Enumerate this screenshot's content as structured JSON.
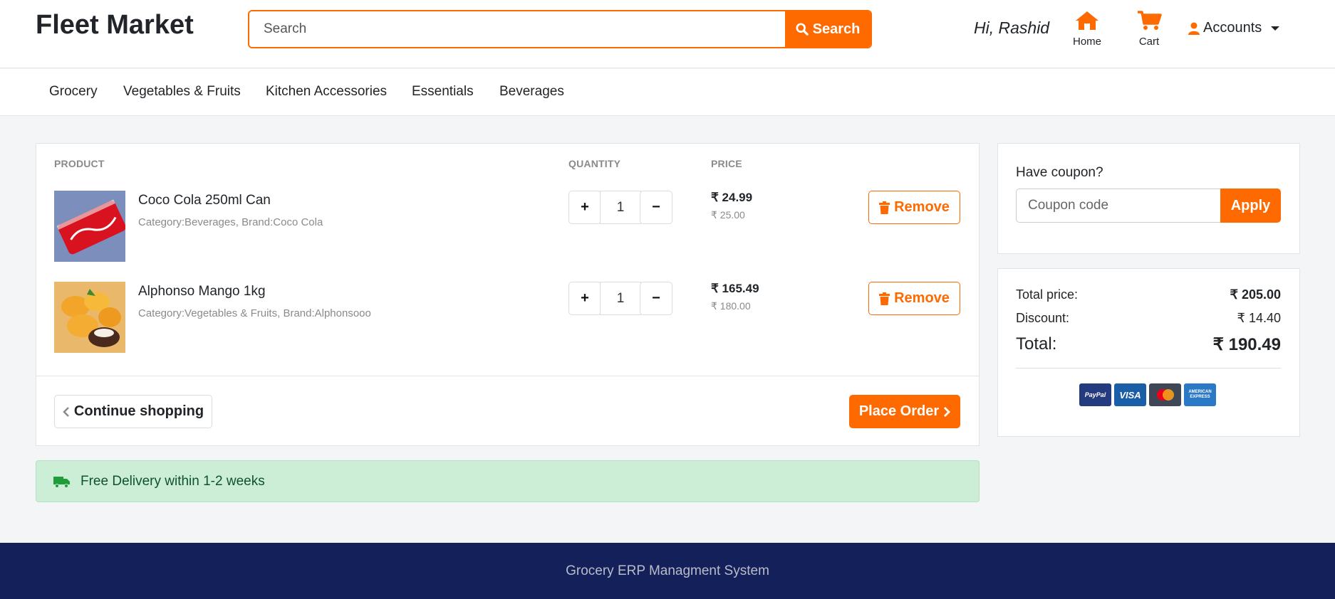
{
  "header": {
    "brand": "Fleet Market",
    "search": {
      "placeholder": "Search",
      "button_label": "Search"
    },
    "greeting": "Hi, Rashid",
    "home_label": "Home",
    "cart_label": "Cart",
    "accounts_label": "Accounts"
  },
  "categories": [
    "Grocery",
    "Vegetables & Fruits",
    "Kitchen Accessories",
    "Essentials",
    "Beverages"
  ],
  "cart": {
    "columns": {
      "product": "PRODUCT",
      "quantity": "QUANTITY",
      "price": "PRICE"
    },
    "items": [
      {
        "name": "Coco Cola 250ml Can",
        "meta": "Category:Beverages, Brand:Coco Cola",
        "quantity": "1",
        "price": "₹ 24.99",
        "old_price": "₹ 25.00",
        "remove_label": "Remove",
        "plus": "+",
        "minus": "−"
      },
      {
        "name": "Alphonso Mango 1kg",
        "meta": "Category:Vegetables & Fruits, Brand:Alphonsooo",
        "quantity": "1",
        "price": "₹ 165.49",
        "old_price": "₹ 180.00",
        "remove_label": "Remove",
        "plus": "+",
        "minus": "−"
      }
    ],
    "continue_label": "Continue shopping",
    "order_label": "Place Order"
  },
  "delivery": {
    "text": "Free Delivery within 1-2 weeks"
  },
  "coupon": {
    "title": "Have coupon?",
    "placeholder": "Coupon code",
    "apply_label": "Apply"
  },
  "totals": {
    "total_price_label": "Total price:",
    "total_price": "₹ 205.00",
    "discount_label": "Discount:",
    "discount": "₹ 14.40",
    "total_label": "Total:",
    "total": "₹ 190.49"
  },
  "payment_logos": {
    "paypal": "PayPal",
    "visa": "VISA",
    "amex": "AMERICAN EXPRESS"
  },
  "footer": {
    "text": "Grocery ERP Managment System"
  },
  "colors": {
    "accent": "#ff6a00",
    "footer_bg": "#13205a",
    "delivery_bg": "#cdeed6",
    "delivery_text": "#0f5132"
  }
}
